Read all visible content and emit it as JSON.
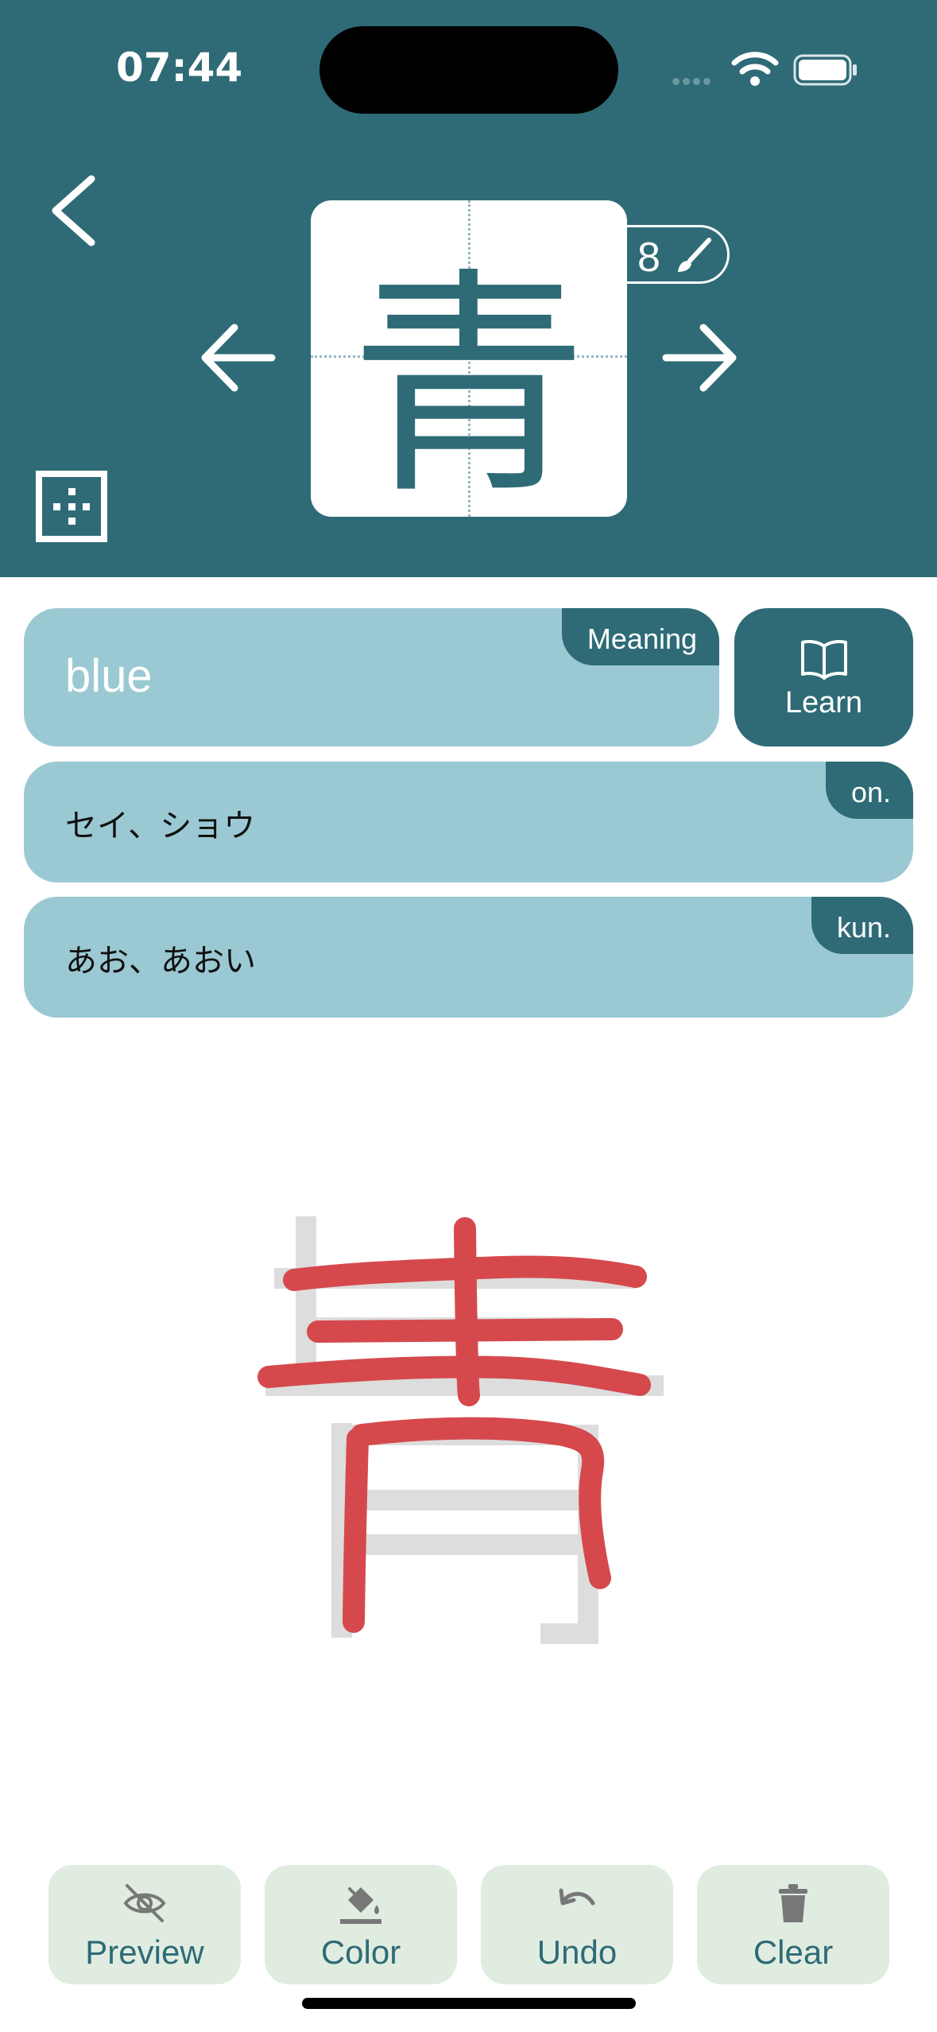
{
  "status_bar": {
    "time": "07:44"
  },
  "kanji": {
    "character": "青",
    "stroke_count": "8"
  },
  "meaning": {
    "tag": "Meaning",
    "value": "blue"
  },
  "learn_button": {
    "label": "Learn"
  },
  "onyomi": {
    "tag": "on.",
    "value": "セイ、ショウ"
  },
  "kunyomi": {
    "tag": "kun.",
    "value": "あお、あおい"
  },
  "toolbar": {
    "preview_label": "Preview",
    "color_label": "Color",
    "undo_label": "Undo",
    "clear_label": "Clear"
  },
  "colors": {
    "header": "#2e6b76",
    "pill": "#9bc9d3",
    "toolbar_button": "#e0ece0",
    "stroke_ink": "#d5494d",
    "guide_char": "#dddddd"
  },
  "icons": {
    "back": "chevron-left-icon",
    "prev": "arrow-left-icon",
    "next": "arrow-right-icon",
    "grid": "grid-icon",
    "stroke": "brush-icon",
    "learn": "book-icon",
    "preview": "eye-slash-icon",
    "color": "paint-bucket-icon",
    "undo": "undo-icon",
    "clear": "trash-icon"
  }
}
